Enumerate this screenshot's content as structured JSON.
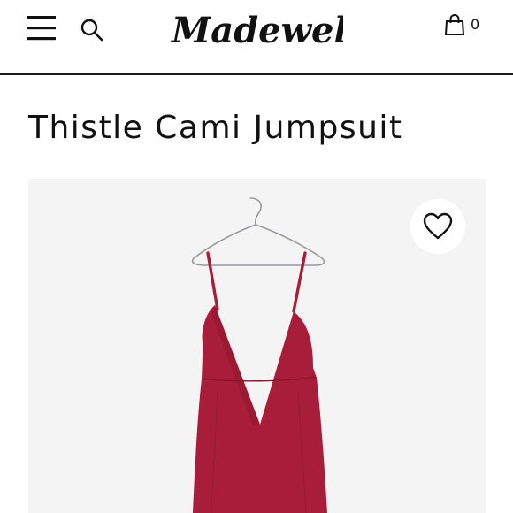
{
  "header": {
    "logo_text": "Madewell",
    "menu_icon": "hamburger-menu-icon",
    "search_icon": "search-icon",
    "bag_icon": "shopping-bag-icon",
    "bag_count": "0"
  },
  "product": {
    "title": "Thistle Cami Jumpsuit",
    "favorite_icon": "heart-icon",
    "garment_color": "#a81e3a"
  },
  "colors": {
    "text": "#111111",
    "image_background": "#f4f4f5",
    "header_rule": "#1a1a1a"
  }
}
